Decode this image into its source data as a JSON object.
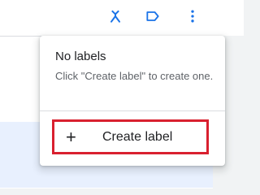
{
  "toolbar": {
    "icons": [
      "merge-icon",
      "label-icon",
      "more-vert-icon"
    ],
    "accent": "#1a73e8"
  },
  "menu": {
    "title": "No labels",
    "hint": "Click \"Create label\" to create one.",
    "create_icon": "+",
    "create_label": "Create label",
    "highlight_color": "#d9202f"
  }
}
